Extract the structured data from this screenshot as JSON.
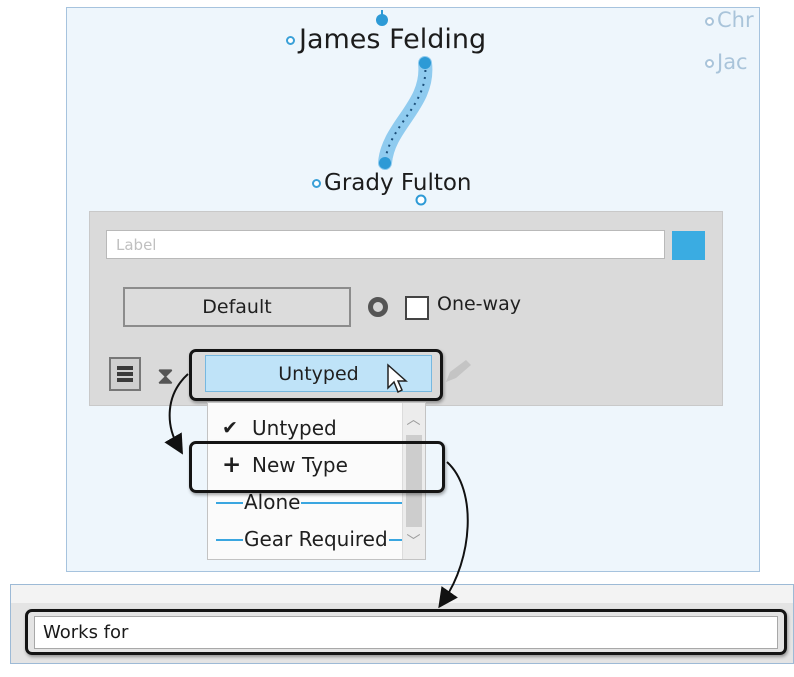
{
  "graph": {
    "nodes": {
      "top": "James Felding",
      "bottom": "Grady Fulton",
      "side_1": "Chr",
      "side_2": "Jac"
    }
  },
  "editor": {
    "label_placeholder": "Label",
    "label_value": "",
    "color_swatch": "#3aace2",
    "default_button": "Default",
    "oneway_label": "One-way",
    "oneway_checked": false,
    "type_combo_value": "Untyped",
    "icons": [
      "list-view-icon",
      "hourglass-icon",
      "pencil-icon",
      "ring-icon"
    ]
  },
  "type_dropdown": {
    "items": [
      {
        "label": "Untyped",
        "glyph": "✔",
        "style": "check"
      },
      {
        "label": "New Type",
        "glyph": "+",
        "style": "add"
      },
      {
        "label": "Alone",
        "glyph": "",
        "style": "line"
      },
      {
        "label": "Gear Required",
        "glyph": "",
        "style": "line"
      }
    ]
  },
  "new_type_editor": {
    "value": "Works for"
  },
  "colors": {
    "accent": "#3aa6e0",
    "edge_highlight": "#8fcbef",
    "combo_selected": "#bfe3f8"
  }
}
